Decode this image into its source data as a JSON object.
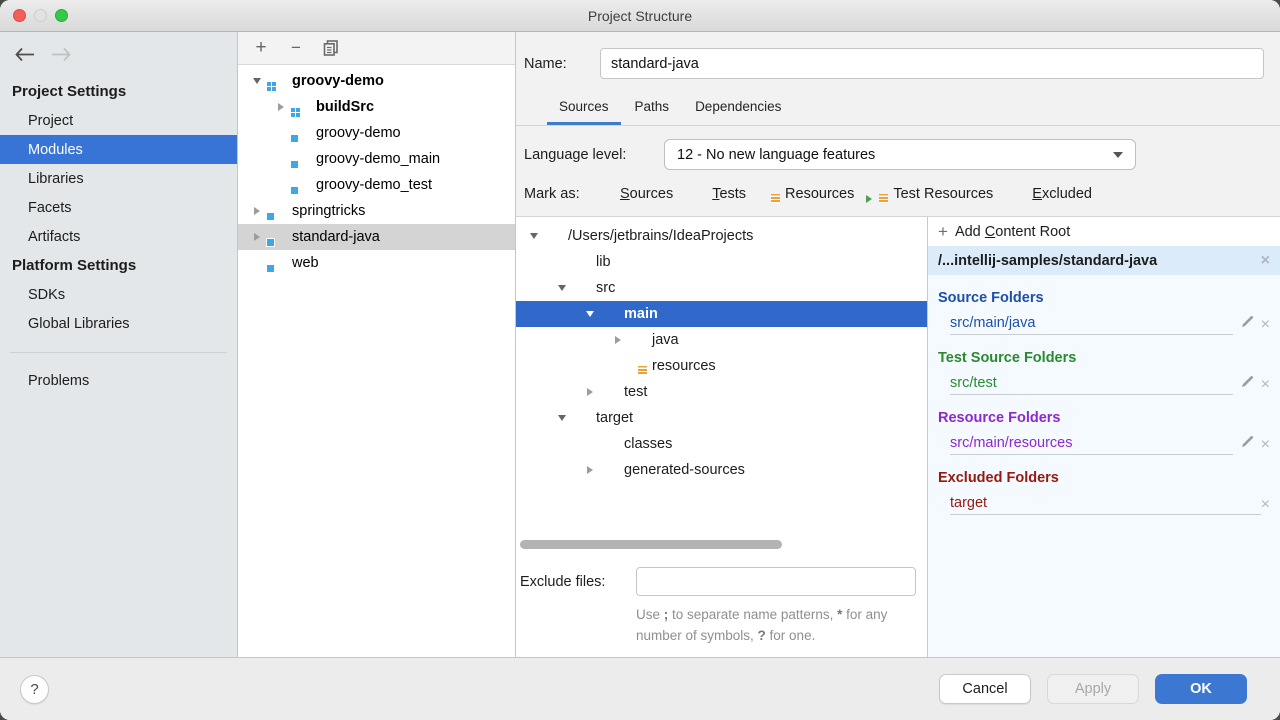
{
  "window": {
    "title": "Project Structure"
  },
  "sidebar": {
    "back_icon": "back-arrow-icon",
    "forward_icon": "forward-arrow-icon",
    "section1_header": "Project Settings",
    "section1_items": [
      "Project",
      "Modules",
      "Libraries",
      "Facets",
      "Artifacts"
    ],
    "section2_header": "Platform Settings",
    "section2_items": [
      "SDKs",
      "Global Libraries"
    ],
    "problems_item": "Problems",
    "selected_item": "Modules"
  },
  "modules_panel": {
    "toolbar_icons": [
      "plus-icon",
      "minus-icon",
      "copy-icon"
    ],
    "rows": [
      {
        "label": "groovy-demo",
        "icon": "gradle-module-folder-icon"
      },
      {
        "label": "buildSrc",
        "icon": "gradle-module-folder-icon"
      },
      {
        "label": "groovy-demo",
        "icon": "module-folder-icon"
      },
      {
        "label": "groovy-demo_main",
        "icon": "module-folder-icon"
      },
      {
        "label": "groovy-demo_test",
        "icon": "module-folder-icon"
      },
      {
        "label": "springtricks",
        "icon": "module-folder-icon"
      },
      {
        "label": "standard-java",
        "icon": "module-folder-icon"
      },
      {
        "label": "web",
        "icon": "module-folder-icon"
      }
    ],
    "selected_row": "standard-java"
  },
  "module_editor": {
    "name_label": "Name:",
    "name_value": "standard-java",
    "tabs": [
      "Sources",
      "Paths",
      "Dependencies"
    ],
    "selected_tab": "Sources",
    "language_level_label": "Language level:",
    "language_level_value": "12 - No new language features",
    "mark_as_label": "Mark as:",
    "mark_as_items": [
      {
        "mnemonic": "S",
        "rest": "ources",
        "icon": "sources-folder-icon",
        "color": "#7dbbe4"
      },
      {
        "mnemonic": "T",
        "rest": "ests",
        "icon": "tests-folder-icon",
        "color": "#8cbe6c"
      },
      {
        "mnemonic": "",
        "rest": "Resources",
        "icon": "resources-folder-icon",
        "color": "#9aa4ad"
      },
      {
        "mnemonic": "",
        "rest": "Test Resources",
        "icon": "test-resources-folder-icon",
        "color": "#9aa4ad"
      },
      {
        "mnemonic": "E",
        "rest": "xcluded",
        "icon": "excluded-folder-icon",
        "color": "#ec8d5c"
      }
    ],
    "tree_rows": [
      {
        "label": "/Users/jetbrains/IdeaProjects",
        "icon": "folder-icon"
      },
      {
        "label": "lib",
        "icon": "folder-icon"
      },
      {
        "label": "src",
        "icon": "folder-icon"
      },
      {
        "label": "main",
        "icon": "folder-icon"
      },
      {
        "label": "java",
        "icon": "source-folder-icon"
      },
      {
        "label": "resources",
        "icon": "resources-folder-icon"
      },
      {
        "label": "test",
        "icon": "test-folder-icon"
      },
      {
        "label": "target",
        "icon": "excluded-folder-icon"
      },
      {
        "label": "classes",
        "icon": "excluded-folder-icon"
      },
      {
        "label": "generated-sources",
        "icon": "excluded-folder-icon"
      }
    ],
    "selected_tree_row": "main",
    "exclude_label": "Exclude files:",
    "exclude_value": "",
    "hint_parts": [
      "Use ",
      ";",
      " to separate name patterns, ",
      "*",
      " for any number of symbols, ",
      "?",
      " for one."
    ]
  },
  "content_roots": {
    "add_prefix": "Add ",
    "add_mnemonic": "C",
    "add_suffix": "ontent Root",
    "root_path": "/...intellij-samples/standard-java",
    "groups": [
      {
        "title": "Source Folders",
        "path": "src/main/java",
        "color": "#1d4fab"
      },
      {
        "title": "Test Source Folders",
        "path": "src/test",
        "color": "#2b8a2f"
      },
      {
        "title": "Resource Folders",
        "path": "src/main/resources",
        "color": "#8d27ce"
      },
      {
        "title": "Excluded Folders",
        "path": "target",
        "color": "#96190f"
      }
    ]
  },
  "footer": {
    "help": "?",
    "cancel": "Cancel",
    "apply": "Apply",
    "ok": "OK"
  },
  "colors": {
    "accent_blue": "#3c78d2",
    "tree_selection_blue": "#3069c9",
    "sidebar_selection_blue": "#3874d6",
    "inactive_selection_gray": "#d4d4d4",
    "content_roots_bg": "#f4faff",
    "content_root_row_bg": "#dcebf9",
    "tab_underline": "#3e7cc7"
  }
}
